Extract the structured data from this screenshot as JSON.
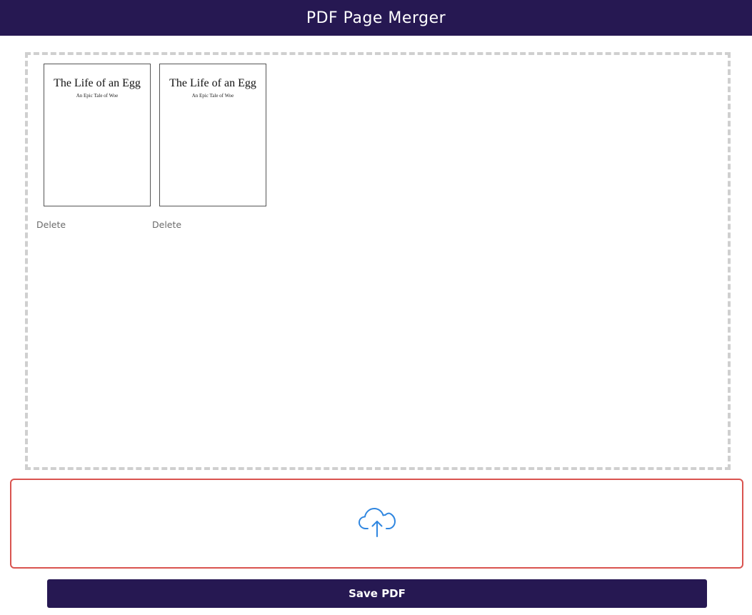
{
  "header": {
    "title": "PDF Page Merger"
  },
  "pages": [
    {
      "title": "The Life of an Egg",
      "subtitle": "An Epic Tale of Woe",
      "delete_label": "Delete"
    },
    {
      "title": "The Life of an Egg",
      "subtitle": "An Epic Tale of Woe",
      "delete_label": "Delete"
    }
  ],
  "upload": {
    "icon": "cloud-upload-icon",
    "icon_color": "#2f86e0",
    "border_color": "#d9534f"
  },
  "actions": {
    "save_label": "Save PDF"
  },
  "colors": {
    "brand": "#261852",
    "dropzone_border": "#cfcfcf"
  }
}
